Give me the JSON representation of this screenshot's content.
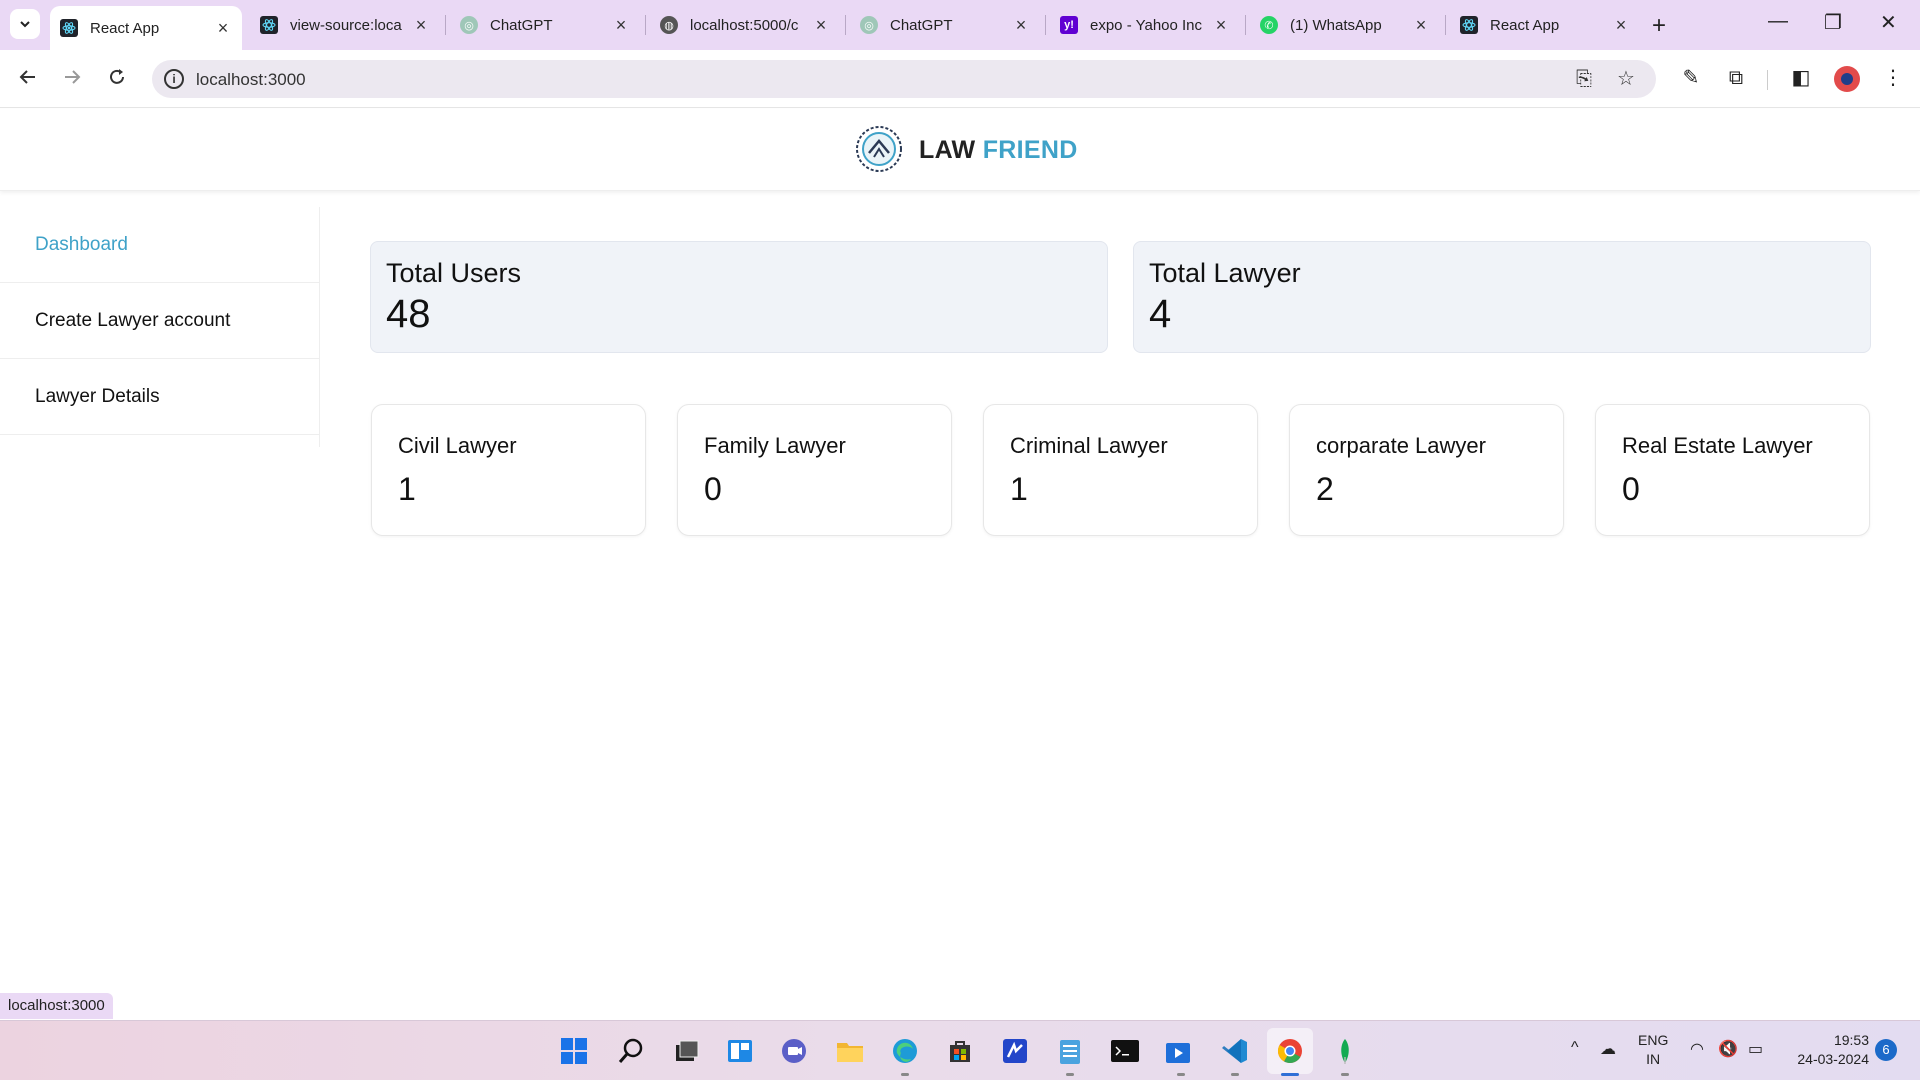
{
  "browser": {
    "tabs": [
      {
        "title": "React App",
        "icon": "react-icon",
        "active": true
      },
      {
        "title": "view-source:loca",
        "icon": "react-icon"
      },
      {
        "title": "ChatGPT",
        "icon": "chatgpt-icon"
      },
      {
        "title": "localhost:5000/c",
        "icon": "globe-icon"
      },
      {
        "title": "ChatGPT",
        "icon": "chatgpt-icon"
      },
      {
        "title": "expo - Yahoo Inc",
        "icon": "yahoo-icon"
      },
      {
        "title": "(1) WhatsApp",
        "icon": "whatsapp-icon"
      },
      {
        "title": "React App",
        "icon": "react-icon"
      }
    ],
    "url": "localhost:3000",
    "status_url": "localhost:3000"
  },
  "header": {
    "brand_part1": "LAW",
    "brand_part2": "FRIEND",
    "brand_accent": "#3fa2c8"
  },
  "sidebar": {
    "items": [
      {
        "label": "Dashboard",
        "active": true
      },
      {
        "label": "Create Lawyer account"
      },
      {
        "label": "Lawyer Details"
      }
    ]
  },
  "summary": [
    {
      "label": "Total Users",
      "value": "48"
    },
    {
      "label": "Total Lawyer",
      "value": "4"
    }
  ],
  "categories": [
    {
      "label": "Civil Lawyer",
      "value": "1"
    },
    {
      "label": "Family Lawyer",
      "value": "0"
    },
    {
      "label": "Criminal Lawyer",
      "value": "1"
    },
    {
      "label": "corparate Lawyer",
      "value": "2"
    },
    {
      "label": "Real Estate Lawyer",
      "value": "0"
    }
  ],
  "taskbar": {
    "lang_line1": "ENG",
    "lang_line2": "IN",
    "time": "19:53",
    "date": "24-03-2024",
    "notification_count": "6"
  }
}
